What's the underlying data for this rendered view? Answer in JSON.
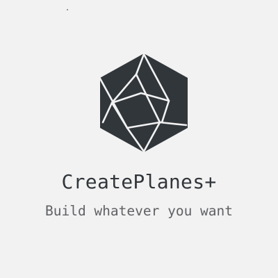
{
  "brand": {
    "name": "CreatePlanes+",
    "tagline": "Build whatever you want",
    "logo_icon": "hexagon-shards-icon",
    "colors": {
      "background": "#f2f2f2",
      "logo": "#31363b",
      "title": "#31363b",
      "tagline": "#5f6165",
      "logo_lines": "#f2f2f2"
    }
  }
}
